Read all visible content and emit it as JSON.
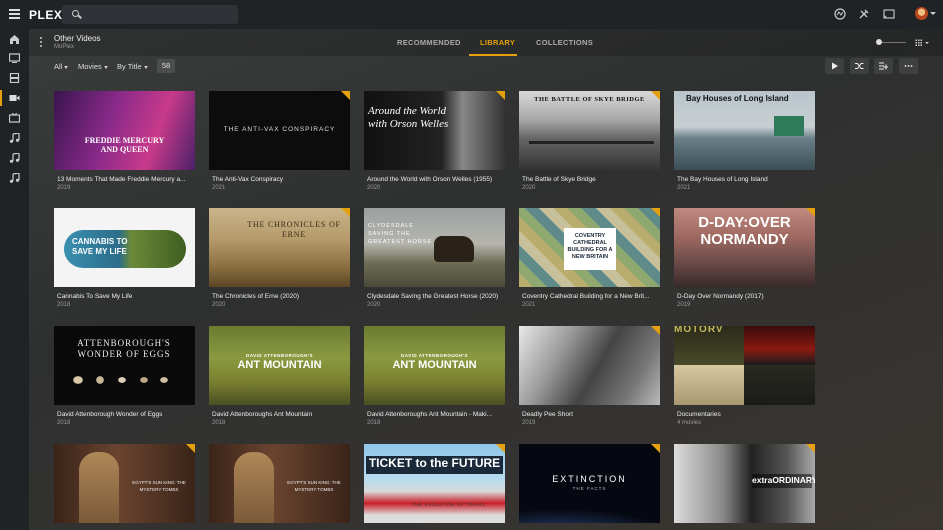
{
  "app": {
    "logo": "PLEX",
    "logo_accent": "#e5a00d"
  },
  "search": {
    "placeholder": ""
  },
  "topbar_icons": [
    "activity-icon",
    "settings-icon",
    "cast-icon",
    "avatar"
  ],
  "sidebar": {
    "items": [
      "home-icon",
      "tv-icon",
      "film-icon",
      "video-icon",
      "tv-icon",
      "music-icon",
      "music-icon",
      "music-icon"
    ],
    "active_index": 3
  },
  "header": {
    "title": "Other Videos",
    "subtitle": "MoPlex"
  },
  "tabs": [
    {
      "label": "RECOMMENDED",
      "active": false
    },
    {
      "label": "LIBRARY",
      "active": true
    },
    {
      "label": "COLLECTIONS",
      "active": false
    }
  ],
  "filters": {
    "all": "All",
    "type": "Movies",
    "sort": "By Title",
    "count": "58"
  },
  "actions": [
    "play-icon",
    "shuffle-icon",
    "add-to-list-icon",
    "more-icon"
  ],
  "items": [
    {
      "title": "13 Moments That Made Freddie Mercury a...",
      "year": "2019",
      "poster_text": "FREDDIE MERCURY AND QUEEN",
      "unwatched": false
    },
    {
      "title": "The Anti-Vax Conspiracy",
      "year": "2021",
      "poster_text": "THE ANTI-VAX CONSPIRACY",
      "unwatched": true
    },
    {
      "title": "Around the World with Orson Welles (1955)",
      "year": "2020",
      "poster_text": "Around the World with Orson Welles",
      "unwatched": true
    },
    {
      "title": "The Battle of Skye Bridge",
      "year": "2020",
      "poster_text": "THE BATTLE OF SKYE BRIDGE",
      "unwatched": true
    },
    {
      "title": "The Bay Houses of Long Island",
      "year": "2021",
      "poster_text": "Bay Houses of Long Island",
      "unwatched": false
    },
    {
      "title": "Cannabis To Save My Life",
      "year": "2018",
      "poster_text": "CANNABIS TO SAVE MY LIFE",
      "unwatched": false
    },
    {
      "title": "The Chronicles of Erne (2020)",
      "year": "2020",
      "poster_text": "THE CHRONICLES OF ERNE",
      "unwatched": true
    },
    {
      "title": "Clydesdale Saving the Greatest Horse (2020)",
      "year": "2020",
      "poster_text": "CLYDESDALE SAVING THE GREATEST HORSE",
      "unwatched": false
    },
    {
      "title": "Coventry Cathedral Building for a New Brit...",
      "year": "2021",
      "poster_text": "COVENTRY CATHEDRAL BUILDING FOR A NEW BRITAIN",
      "unwatched": true
    },
    {
      "title": "D-Day Over Normandy (2017)",
      "year": "2019",
      "poster_text": "D-DAY:OVER NORMANDY",
      "unwatched": true
    },
    {
      "title": "David Attenborough Wonder of Eggs",
      "year": "2018",
      "poster_text": "ATTENBOROUGH'S WONDER OF EGGS",
      "unwatched": false
    },
    {
      "title": "David Attenboroughs Ant Mountain",
      "year": "2018",
      "poster_text": "ANT MOUNTAIN",
      "poster_pre": "DAVID ATTENBOROUGH'S",
      "unwatched": false
    },
    {
      "title": "David Attenboroughs Ant Mountain - Maki...",
      "year": "2018",
      "poster_text": "ANT MOUNTAIN",
      "poster_pre": "DAVID ATTENBOROUGH'S",
      "unwatched": false
    },
    {
      "title": "Deadly Pee Short",
      "year": "2019",
      "poster_text": "",
      "unwatched": true
    },
    {
      "title": "Documentaries",
      "year": "4 movies",
      "poster_text": "MOTORV",
      "unwatched": false
    },
    {
      "title": "",
      "year": "",
      "poster_text": "EGYPT'S SUN KING: THE MYSTERY TOMBS",
      "unwatched": true
    },
    {
      "title": "",
      "year": "",
      "poster_text": "EGYPT'S SUN KING: THE MYSTERY TOMBS",
      "unwatched": false
    },
    {
      "title": "",
      "year": "",
      "poster_text": "TICKET to the FUTURE",
      "poster_sub": "THE EVOLUTION OF TRAVEL",
      "unwatched": true
    },
    {
      "title": "",
      "year": "",
      "poster_text": "EXTINCTION",
      "poster_sub": "THE FACTS",
      "unwatched": true
    },
    {
      "title": "",
      "year": "",
      "poster_text": "extraORDINARY",
      "unwatched": true
    }
  ]
}
